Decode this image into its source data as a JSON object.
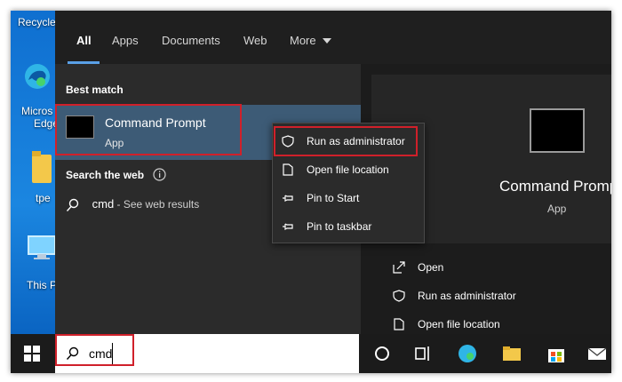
{
  "desktop": {
    "recycle_label": "Recycle",
    "edge_label_1": "Micros",
    "edge_label_2": "Edge",
    "folder_label": "tpe",
    "pc_label": "This P"
  },
  "tabs": [
    {
      "label": "All",
      "active": true
    },
    {
      "label": "Apps"
    },
    {
      "label": "Documents"
    },
    {
      "label": "Web"
    },
    {
      "label": "More"
    }
  ],
  "left": {
    "best_match_heading": "Best match",
    "best_match": {
      "title": "Command Prompt",
      "subtitle": "App"
    },
    "search_web_heading": "Search the web",
    "web_result": {
      "query": "cmd",
      "suffix": " - See web results"
    }
  },
  "context_menu": {
    "items": [
      {
        "label": "Run as administrator",
        "icon": "shield-icon"
      },
      {
        "label": "Open file location",
        "icon": "folder-open-icon"
      },
      {
        "label": "Pin to Start",
        "icon": "pin-icon"
      },
      {
        "label": "Pin to taskbar",
        "icon": "pin-icon"
      }
    ]
  },
  "right": {
    "title": "Command Prompt",
    "subtitle": "App",
    "actions": [
      {
        "label": "Open",
        "icon": "open-icon"
      },
      {
        "label": "Run as administrator",
        "icon": "shield-icon"
      },
      {
        "label": "Open file location",
        "icon": "folder-open-icon"
      }
    ]
  },
  "taskbar": {
    "search_value": "cmd"
  },
  "colors": {
    "highlight": "#d0202a",
    "accent": "#5aa0e6",
    "selected_row": "#3d5b76"
  }
}
